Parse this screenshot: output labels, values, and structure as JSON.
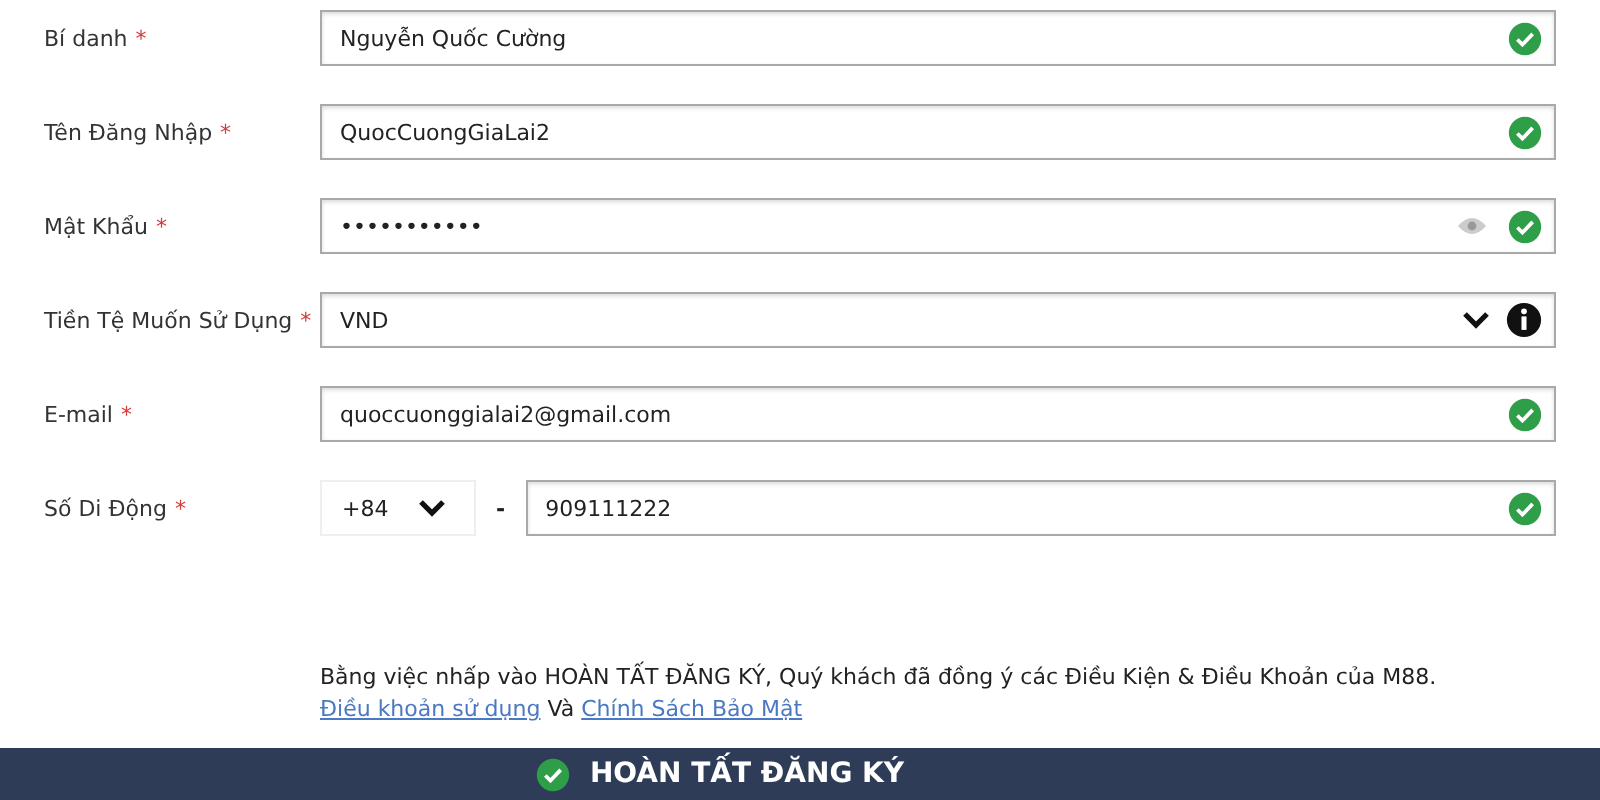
{
  "fields": [
    {
      "label": "Bí danh",
      "required_mark": "*",
      "kind": "text",
      "value": "Nguyễn Quốc Cường",
      "valid": true
    },
    {
      "label": "Tên Đăng Nhập",
      "required_mark": "*",
      "kind": "text",
      "value": "QuocCuongGiaLai2",
      "valid": true
    },
    {
      "label": "Mật Khẩu",
      "required_mark": "*",
      "kind": "password",
      "value": "•••••••••••",
      "valid": true
    },
    {
      "label": "Tiền Tệ Muốn Sử Dụng",
      "required_mark": "*",
      "kind": "select",
      "value": "VND",
      "valid": false
    },
    {
      "label": "E-mail",
      "required_mark": "*",
      "kind": "text",
      "value": "quoccuonggialai2@gmail.com",
      "valid": true
    },
    {
      "label": "Số Di Động",
      "required_mark": "*",
      "kind": "phone",
      "prefix": "+84",
      "separator": "-",
      "value": "909111222",
      "valid": true
    }
  ],
  "terms": {
    "text": "Bằng việc nhấp vào HOÀN TẤT ĐĂNG KÝ, Quý khách đã đồng ý các Điều Kiện & Điều Khoản của M88.",
    "links": [
      "Điều khoản sử dụng",
      "Chính Sách Bảo Mật"
    ],
    "joiner": "Và"
  },
  "submit": {
    "label": "HOÀN TẤT ĐĂNG KÝ"
  }
}
